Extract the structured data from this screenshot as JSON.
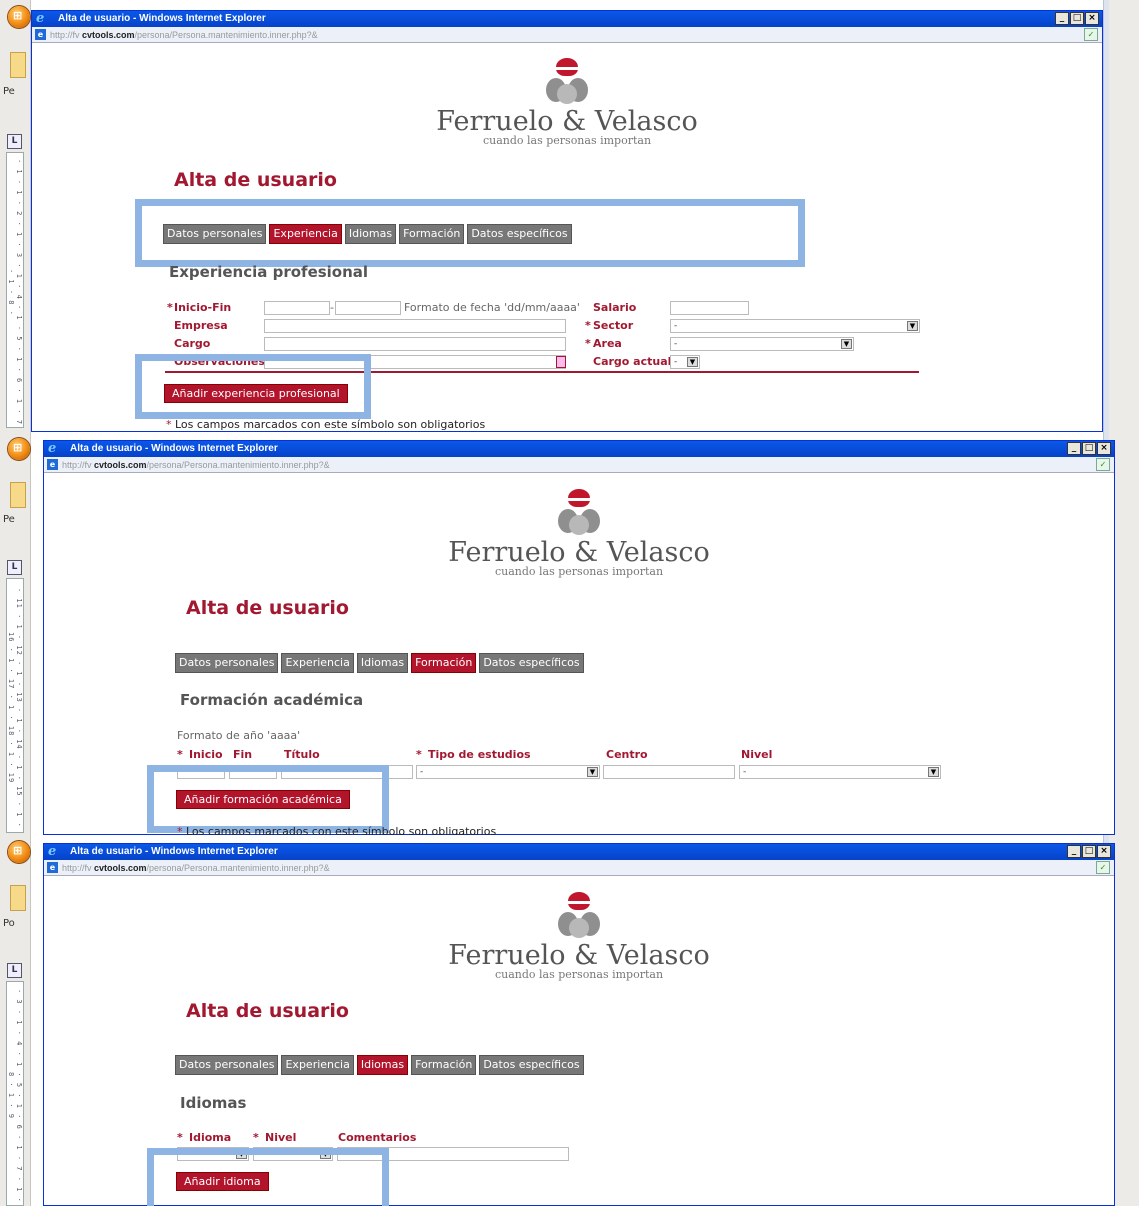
{
  "window": {
    "title": "Alta de usuario - Windows Internet Explorer",
    "url_prefix": "http://fv ",
    "url_domain": "cvtools.com",
    "url_path": "/persona/Persona.mantenimiento.inner.php?&"
  },
  "side": {
    "p1": "Pe",
    "p2": "Pe",
    "p3": "Po",
    "ruler_btn": "L"
  },
  "logo": {
    "name": "Ferruelo & Velasco",
    "tagline": "cuando las personas importan"
  },
  "page_title": "Alta de usuario",
  "tabs": [
    "Datos personales",
    "Experiencia",
    "Idiomas",
    "Formación",
    "Datos específicos"
  ],
  "asterisk": "*",
  "panel1": {
    "heading": "Experiencia profesional",
    "inicio_fin": "Inicio-Fin",
    "date_sep": "-",
    "date_format": "Formato de fecha 'dd/mm/aaaa'",
    "salario": "Salario",
    "empresa": "Empresa",
    "sector": "Sector",
    "sector_value": "-",
    "cargo": "Cargo",
    "area": "Area",
    "area_value": "-",
    "observaciones": "Observaciones",
    "cargo_actual": "Cargo actual",
    "cargo_actual_value": "-",
    "add_button": "Añadir experiencia profesional",
    "footnote": "Los campos marcados con este símbolo son obligatorios"
  },
  "panel2": {
    "heading": "Formación académica",
    "year_format": "Formato de año 'aaaa'",
    "inicio": "Inicio",
    "fin": "Fin",
    "titulo": "Título",
    "tipo_estudios": "Tipo de estudios",
    "tipo_value": "-",
    "centro": "Centro",
    "nivel": "Nivel",
    "nivel_value": "-",
    "add_button": "Añadir formación académica",
    "footnote": "Los campos marcados con este símbolo son obligatorios"
  },
  "panel3": {
    "heading": "Idiomas",
    "idioma": "Idioma",
    "nivel": "Nivel",
    "comentarios": "Comentarios",
    "add_button": "Añadir idioma"
  },
  "ruler": {
    "r1": "· 1 · 1 · 2 · 1 · 3 · 1 · 4 · 1 · 5 · 1 · 6 · 1 · 7 · 1 · 8 ·",
    "r2": "· 11 · 1 · 12 · 1 · 13 · 1 · 14 · 1 · 15 · 1 · 16 · 1 · 17 · 1 · 18 · 1 · 19",
    "r3": "· 3 · 1 · 4 · 1 · 5 · 1 · 6 · 1 · 7 · 1 · 8 · 1 · 9"
  },
  "colors": {
    "accent": "#a11830",
    "tab_inactive": "#777777",
    "highlight": "#8eb4e3",
    "titlebar": "#0a58e8"
  }
}
